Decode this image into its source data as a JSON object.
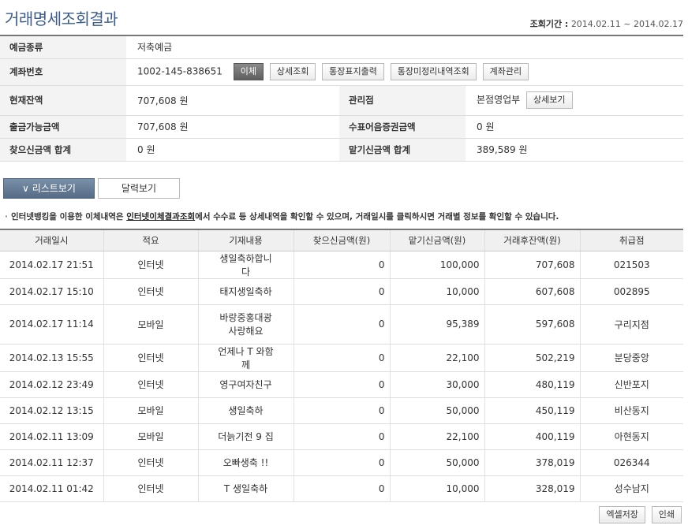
{
  "page": {
    "title": "거래명세조회결과",
    "period_label": "조회기간 :",
    "period_value": "2014.02.11 ~ 2014.02.17"
  },
  "account": {
    "type_label": "예금종류",
    "type_value": "저축예금",
    "number_label": "계좌번호",
    "number_value": "1002-145-838651",
    "buttons": [
      "이체",
      "상세조회",
      "통장표지출력",
      "통장미정리내역조회",
      "계좌관리"
    ],
    "balance_label": "현재잔액",
    "balance_value": "707,608 원",
    "branch_label": "관리점",
    "branch_value": "본점영업부",
    "branch_detail_button": "상세보기",
    "withdrawable_label": "출금가능금액",
    "withdrawable_value": "707,608 원",
    "check_label": "수표어음증권금액",
    "check_value": "0 원",
    "withdraw_total_label": "찾으신금액 합계",
    "withdraw_total_value": "0 원",
    "deposit_total_label": "맡기신금액 합계",
    "deposit_total_value": "389,589 원"
  },
  "view_tabs": {
    "list": "리스트보기",
    "calendar": "달력보기"
  },
  "notice": {
    "before": "인터넷뱅킹을 이용한 이체내역은 ",
    "link": "인터넷이체결과조회",
    "after": "에서 수수료 등 상세내역을 확인할 수 있으며, 거래일시를 클릭하시면 거래별 정보를 확인할 수 있습니다."
  },
  "table": {
    "headers": [
      "거래일시",
      "적요",
      "기재내용",
      "찾으신금액(원)",
      "맡기신금액(원)",
      "거래후잔액(원)",
      "취급점"
    ],
    "rows": [
      [
        "2014.02.17 21:51",
        "인터넷",
        "생일축하합니다",
        "0",
        "100,000",
        "707,608",
        "021503"
      ],
      [
        "2014.02.17 15:10",
        "인터넷",
        "태지생일축하",
        "0",
        "10,000",
        "607,608",
        "002895"
      ],
      [
        "2014.02.17 11:14",
        "모바일",
        "바랑중홍대광사랑해요",
        "0",
        "95,389",
        "597,608",
        "구리지점"
      ],
      [
        "2014.02.13 15:55",
        "인터넷",
        "언제나 T 와함께",
        "0",
        "22,100",
        "502,219",
        "분당중앙"
      ],
      [
        "2014.02.12 23:49",
        "인터넷",
        "영구여자친구",
        "0",
        "30,000",
        "480,119",
        "신반포지"
      ],
      [
        "2014.02.12 13:15",
        "모바일",
        "생일축하",
        "0",
        "50,000",
        "450,119",
        "비산동지"
      ],
      [
        "2014.02.11 13:09",
        "모바일",
        "더늙기전 9 집",
        "0",
        "22,100",
        "400,119",
        "아현동지"
      ],
      [
        "2014.02.11 12:37",
        "인터넷",
        "오빠생축 !!",
        "0",
        "50,000",
        "378,019",
        "026344"
      ],
      [
        "2014.02.11 01:42",
        "인터넷",
        "T 생일축하",
        "0",
        "10,000",
        "328,019",
        "성수남지"
      ]
    ]
  },
  "bottom_buttons": {
    "excel": "엑셀저장",
    "print": "인쇄"
  }
}
